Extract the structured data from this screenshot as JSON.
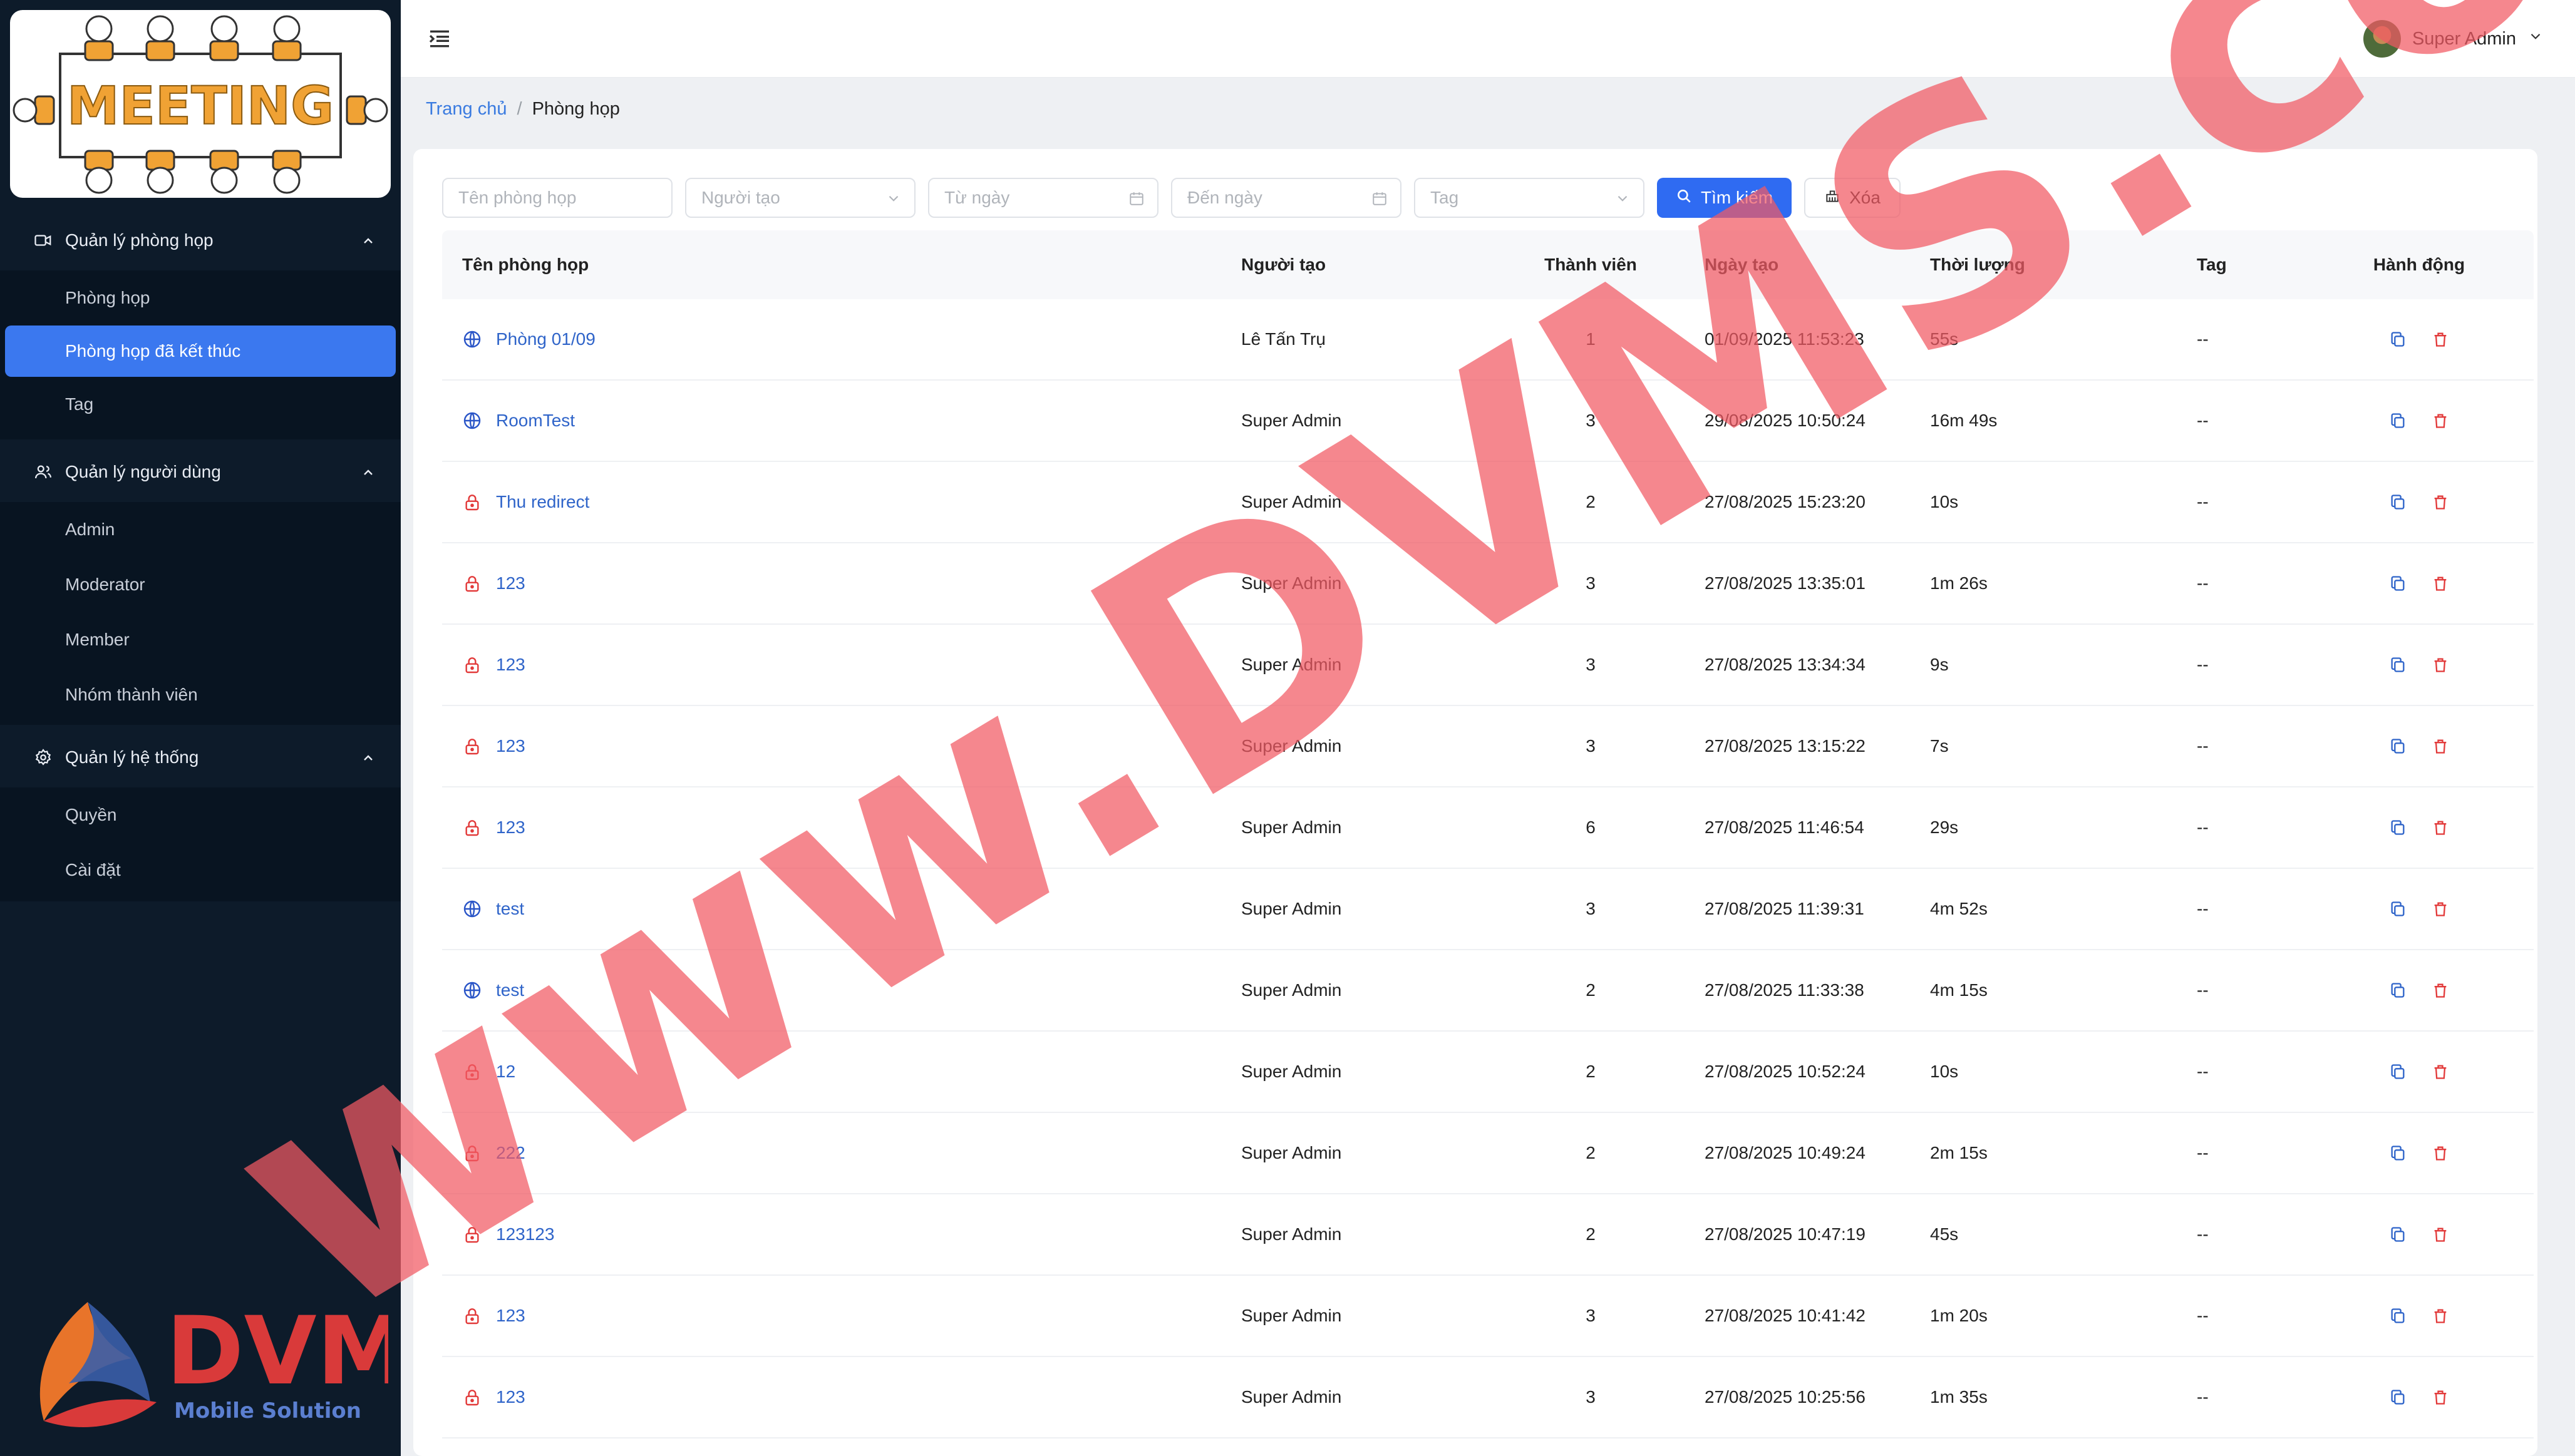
{
  "logo": {
    "text": "MEETING"
  },
  "brand": {
    "name": "DVMS",
    "tagline": "Mobile Solution"
  },
  "sidebar": {
    "groups": [
      {
        "label": "Quản lý phòng họp",
        "icon": "video-camera-icon",
        "items": [
          {
            "label": "Phòng họp"
          },
          {
            "label": "Phòng họp đã kết thúc",
            "active": true
          },
          {
            "label": "Tag"
          }
        ]
      },
      {
        "label": "Quản lý người dùng",
        "icon": "users-icon",
        "items": [
          {
            "label": "Admin"
          },
          {
            "label": "Moderator"
          },
          {
            "label": "Member"
          },
          {
            "label": "Nhóm thành viên"
          }
        ]
      },
      {
        "label": "Quản lý hệ thống",
        "icon": "gear-icon",
        "items": [
          {
            "label": "Quyền"
          },
          {
            "label": "Cài đặt"
          }
        ]
      }
    ],
    "active_color": "#3b78ef"
  },
  "header": {
    "user_name": "Super Admin"
  },
  "breadcrumb": {
    "home": "Trang chủ",
    "separator": "/",
    "current": "Phòng họp"
  },
  "filters": {
    "room_name_placeholder": "Tên phòng họp",
    "creator_placeholder": "Người tạo",
    "from_date_placeholder": "Từ ngày",
    "to_date_placeholder": "Đến ngày",
    "tag_placeholder": "Tag",
    "search_label": "Tìm kiếm",
    "clear_label": "Xóa"
  },
  "table": {
    "headers": [
      "Tên phòng họp",
      "Người tạo",
      "Thành viên",
      "Ngày tạo",
      "Thời lượng",
      "Tag",
      "Hành động"
    ],
    "rows": [
      {
        "type": "public",
        "name": "Phòng 01/09",
        "creator": "Lê Tấn Trụ",
        "members": "1",
        "created": "01/09/2025 11:53:23",
        "duration": "55s",
        "tag": "--"
      },
      {
        "type": "public",
        "name": "RoomTest",
        "creator": "Super Admin",
        "members": "3",
        "created": "29/08/2025 10:50:24",
        "duration": "16m 49s",
        "tag": "--"
      },
      {
        "type": "private",
        "name": "Thu redirect",
        "creator": "Super Admin",
        "members": "2",
        "created": "27/08/2025 15:23:20",
        "duration": "10s",
        "tag": "--"
      },
      {
        "type": "private",
        "name": "123",
        "creator": "Super Admin",
        "members": "3",
        "created": "27/08/2025 13:35:01",
        "duration": "1m 26s",
        "tag": "--"
      },
      {
        "type": "private",
        "name": "123",
        "creator": "Super Admin",
        "members": "3",
        "created": "27/08/2025 13:34:34",
        "duration": "9s",
        "tag": "--"
      },
      {
        "type": "private",
        "name": "123",
        "creator": "Super Admin",
        "members": "3",
        "created": "27/08/2025 13:15:22",
        "duration": "7s",
        "tag": "--"
      },
      {
        "type": "private",
        "name": "123",
        "creator": "Super Admin",
        "members": "6",
        "created": "27/08/2025 11:46:54",
        "duration": "29s",
        "tag": "--"
      },
      {
        "type": "public",
        "name": "test",
        "creator": "Super Admin",
        "members": "3",
        "created": "27/08/2025 11:39:31",
        "duration": "4m 52s",
        "tag": "--"
      },
      {
        "type": "public",
        "name": "test",
        "creator": "Super Admin",
        "members": "2",
        "created": "27/08/2025 11:33:38",
        "duration": "4m 15s",
        "tag": "--"
      },
      {
        "type": "private",
        "name": "12",
        "creator": "Super Admin",
        "members": "2",
        "created": "27/08/2025 10:52:24",
        "duration": "10s",
        "tag": "--"
      },
      {
        "type": "private",
        "name": "222",
        "creator": "Super Admin",
        "members": "2",
        "created": "27/08/2025 10:49:24",
        "duration": "2m 15s",
        "tag": "--"
      },
      {
        "type": "private",
        "name": "123123",
        "creator": "Super Admin",
        "members": "2",
        "created": "27/08/2025 10:47:19",
        "duration": "45s",
        "tag": "--"
      },
      {
        "type": "private",
        "name": "123",
        "creator": "Super Admin",
        "members": "3",
        "created": "27/08/2025 10:41:42",
        "duration": "1m 20s",
        "tag": "--"
      },
      {
        "type": "private",
        "name": "123",
        "creator": "Super Admin",
        "members": "3",
        "created": "27/08/2025 10:25:56",
        "duration": "1m 35s",
        "tag": "--"
      }
    ]
  },
  "watermark": {
    "text": "www.DVMS.com.vn"
  }
}
